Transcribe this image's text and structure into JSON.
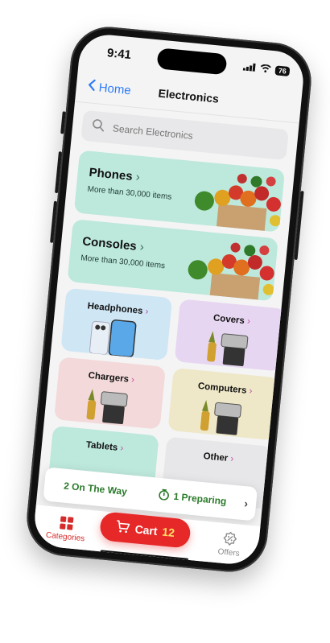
{
  "status": {
    "time": "9:41",
    "battery": "76"
  },
  "nav": {
    "back_label": "Home",
    "title": "Electronics"
  },
  "search": {
    "placeholder": "Search Electronics"
  },
  "banners": [
    {
      "title": "Phones",
      "subtitle": "More than 30,000 items"
    },
    {
      "title": "Consoles",
      "subtitle": "More than 30,000 items"
    }
  ],
  "tiles": [
    {
      "label": "Headphones",
      "bg": "#cfe6f5"
    },
    {
      "label": "Covers",
      "bg": "#e7d6f1"
    },
    {
      "label": "Chargers",
      "bg": "#f3d9da"
    },
    {
      "label": "Computers",
      "bg": "#eee8c8"
    },
    {
      "label": "Tablets",
      "bg": "#bde8dc"
    },
    {
      "label": "Other",
      "bg": "#e7e7e9"
    }
  ],
  "order_status": {
    "on_the_way": "2 On The Way",
    "preparing": "1 Preparing"
  },
  "tabbar": {
    "categories": "Categories",
    "cart_label": "Cart",
    "cart_count": "12",
    "offers": "Offers"
  },
  "colors": {
    "accent": "#e62828",
    "link": "#2f7cf6",
    "green": "#2a7a2a"
  }
}
